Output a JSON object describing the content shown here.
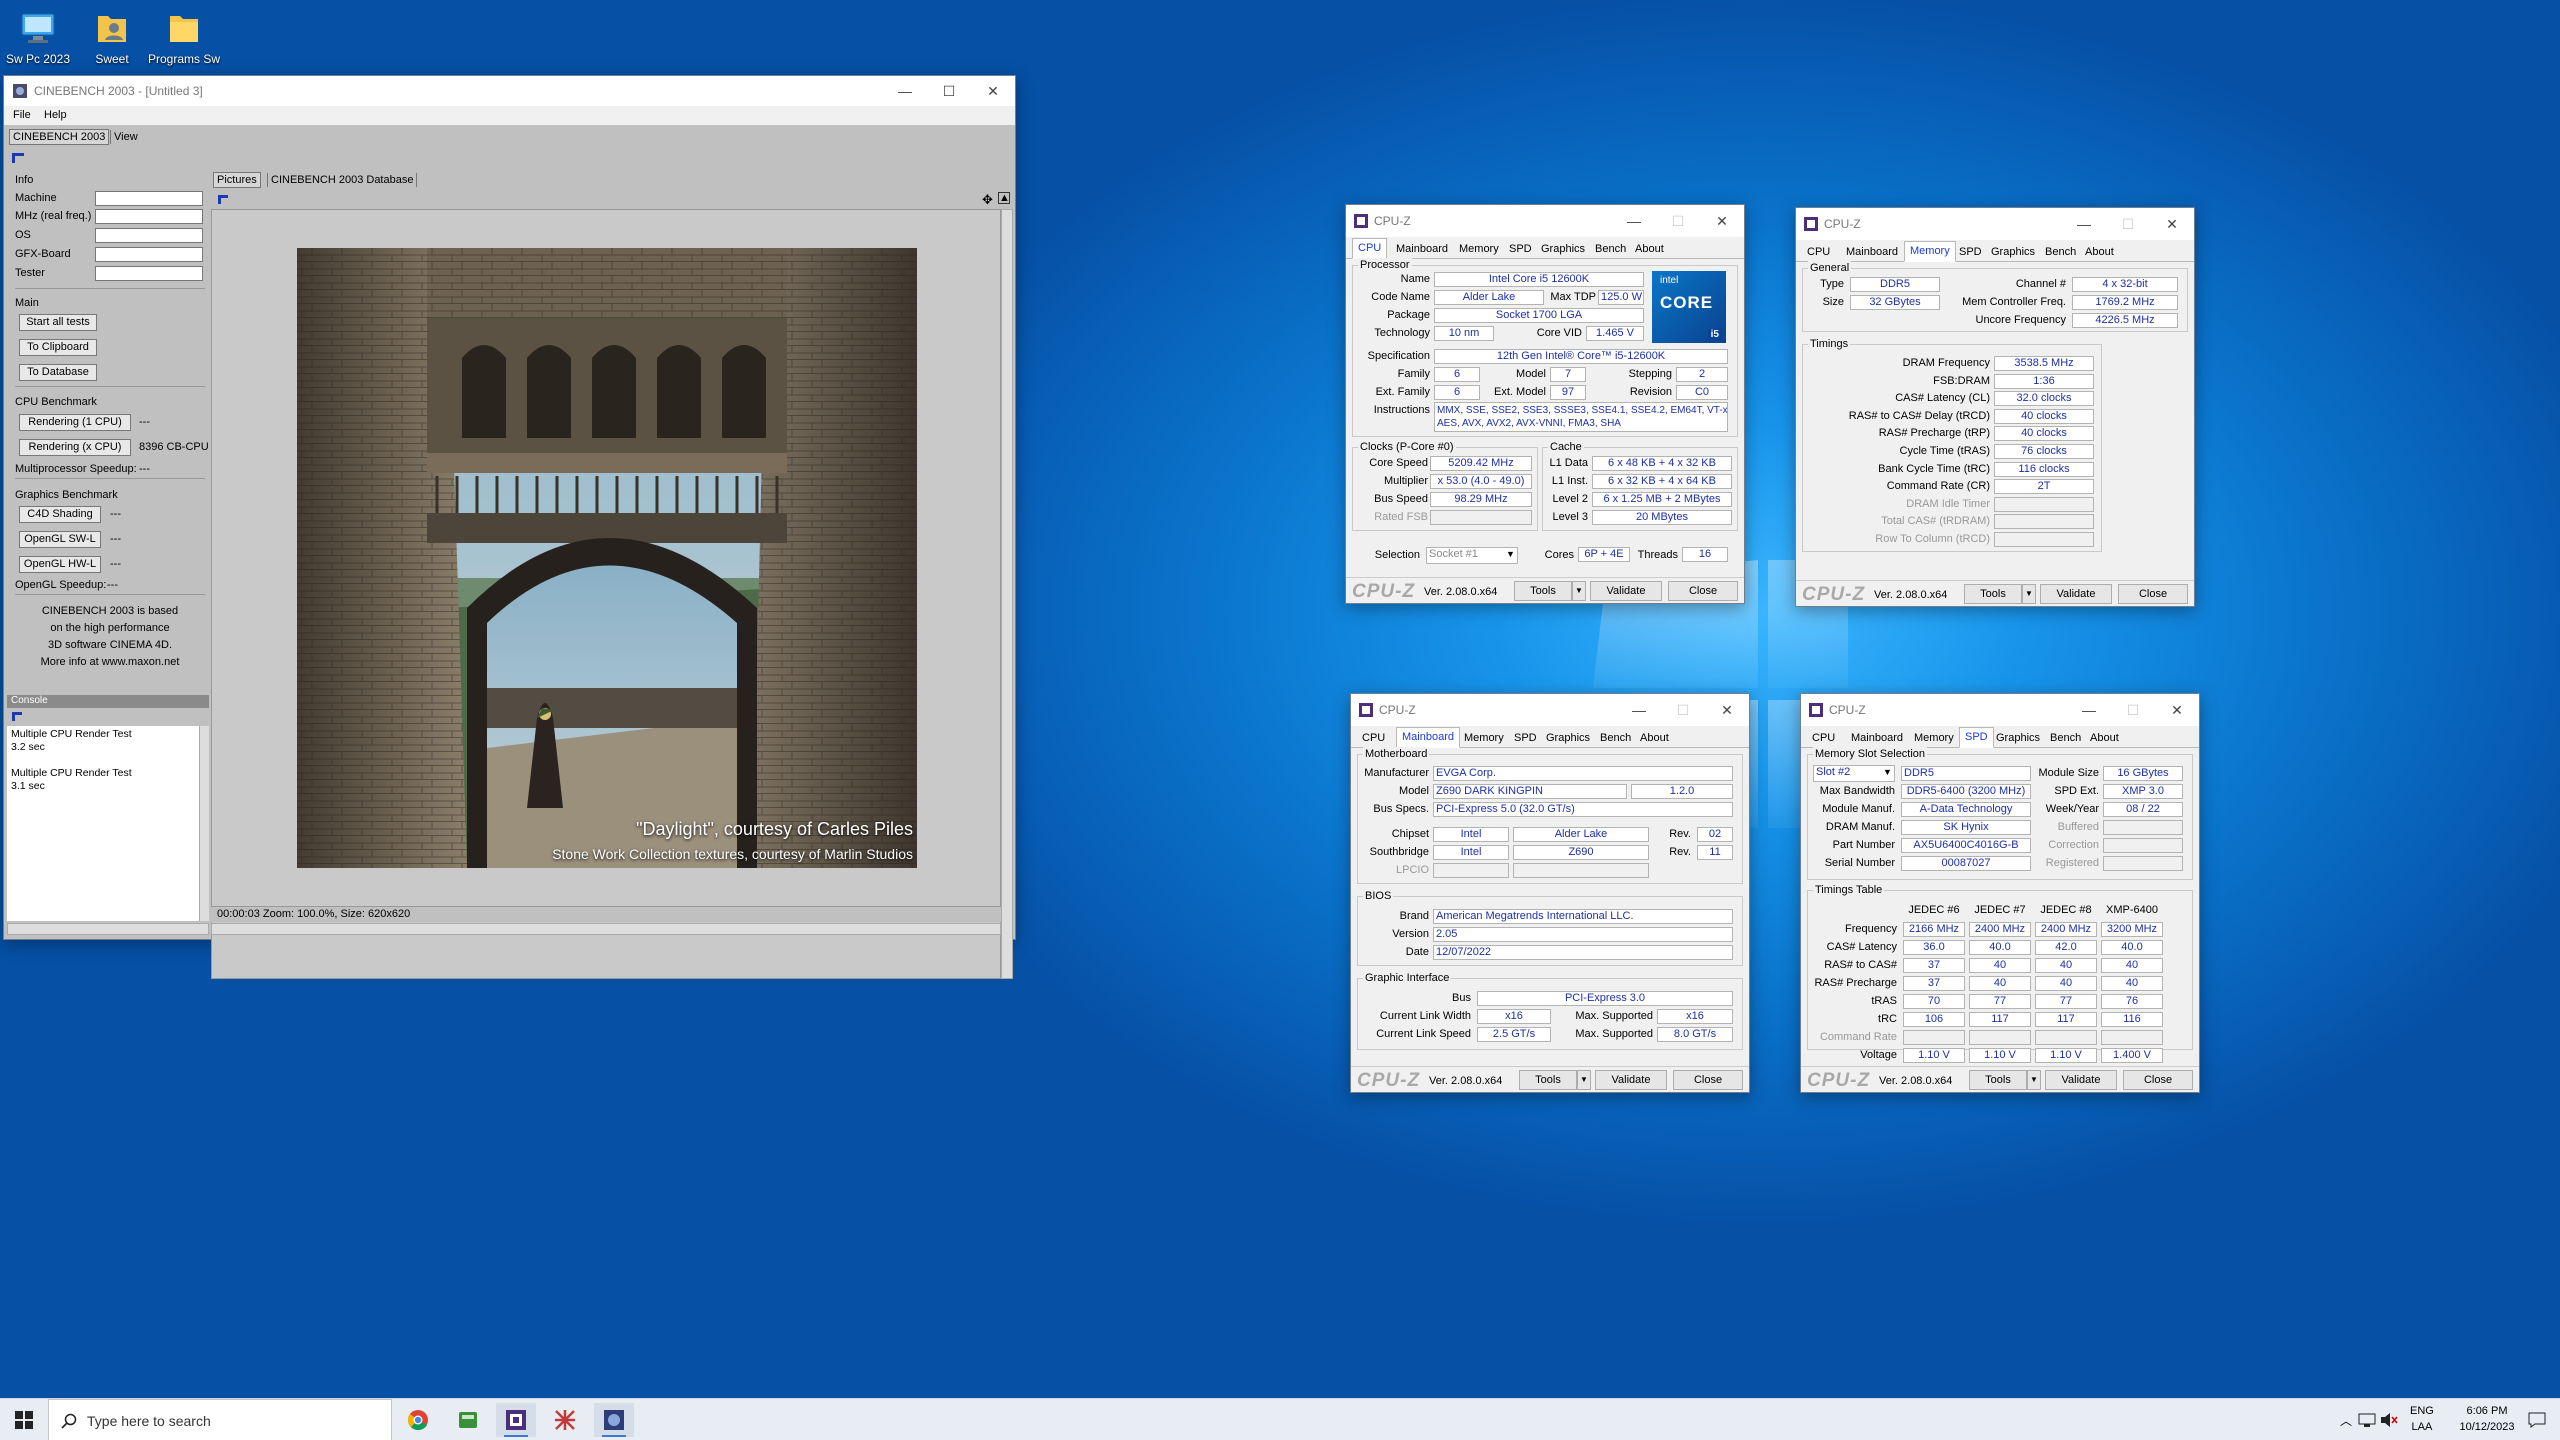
{
  "desktop_icons": [
    {
      "label": "Sw Pc 2023",
      "icon": "computer-icon"
    },
    {
      "label": "Sweet",
      "icon": "user-folder-icon"
    },
    {
      "label": "Programs Sw",
      "icon": "folder-icon"
    }
  ],
  "cinebench": {
    "title": "CINEBENCH 2003 - [Untitled 3]",
    "menu": [
      "File",
      "Help"
    ],
    "tabs": [
      "CINEBENCH 2003",
      "View"
    ],
    "info_title": "Info",
    "info_labels": [
      "Machine",
      "MHz (real freq.)",
      "OS",
      "GFX-Board",
      "Tester"
    ],
    "main_title": "Main",
    "main_buttons": [
      "Start all tests",
      "To Clipboard",
      "To Database"
    ],
    "cpu_title": "CPU Benchmark",
    "render1": "Rendering (1 CPU)",
    "render1_val": "---",
    "renderx": "Rendering (x CPU)",
    "renderx_val": "8396 CB-CPU",
    "mp_speedup": "Multiprocessor Speedup:",
    "mp_val": "---",
    "gfx_title": "Graphics Benchmark",
    "gfx_buttons": [
      "C4D Shading",
      "OpenGL SW-L",
      "OpenGL HW-L"
    ],
    "gfx_vals": [
      "---",
      "---",
      "---"
    ],
    "ogl_speedup": "OpenGL Speedup:",
    "ogl_val": "---",
    "about": [
      "CINEBENCH 2003 is based",
      "on the high performance",
      "3D software CINEMA 4D.",
      "More info at www.maxon.net"
    ],
    "console_title": "Console",
    "console_lines": [
      "Multiple CPU Render Test",
      "3.2 sec",
      "",
      "Multiple CPU Render Test",
      "3.1 sec"
    ],
    "pic_tabs": [
      "Pictures",
      "CINEBENCH 2003 Database"
    ],
    "caption1": "\"Daylight\", courtesy of Carles Piles",
    "caption2": "Stone Work Collection textures, courtesy of Marlin Studios",
    "status": "00:00:03   Zoom: 100.0%, Size: 620x620"
  },
  "cpuz_common": {
    "title": "CPU-Z",
    "tabs": [
      "CPU",
      "Mainboard",
      "Memory",
      "SPD",
      "Graphics",
      "Bench",
      "About"
    ],
    "logo": "CPU-Z",
    "version": "Ver. 2.08.0.x64",
    "tools": "Tools",
    "validate": "Validate",
    "close": "Close"
  },
  "cpuz_cpu": {
    "processor": "Processor",
    "name_l": "Name",
    "name": "Intel Core i5 12600K",
    "code_l": "Code Name",
    "code": "Alder Lake",
    "tdp_l": "Max TDP",
    "tdp": "125.0 W",
    "pkg_l": "Package",
    "pkg": "Socket 1700 LGA",
    "tech_l": "Technology",
    "tech": "10 nm",
    "vid_l": "Core VID",
    "vid": "1.465 V",
    "spec_l": "Specification",
    "spec": "12th Gen Intel® Core™ i5-12600K",
    "fam_l": "Family",
    "fam": "6",
    "model_l": "Model",
    "model": "7",
    "step_l": "Stepping",
    "step": "2",
    "efam_l": "Ext. Family",
    "efam": "6",
    "emodel_l": "Ext. Model",
    "emodel": "97",
    "rev_l": "Revision",
    "rev": "C0",
    "instr_l": "Instructions",
    "instr1": "MMX, SSE, SSE2, SSE3, SSSE3, SSE4.1, SSE4.2, EM64T, VT-x,",
    "instr2": "AES, AVX, AVX2, AVX-VNNI, FMA3, SHA",
    "clocks": "Clocks (P-Core #0)",
    "cs_l": "Core Speed",
    "cs": "5209.42 MHz",
    "mul_l": "Multiplier",
    "mul": "x 53.0 (4.0 - 49.0)",
    "bus_l": "Bus Speed",
    "bus": "98.29 MHz",
    "fsb_l": "Rated FSB",
    "cache": "Cache",
    "l1d_l": "L1 Data",
    "l1d": "6 x 48 KB + 4 x 32 KB",
    "l1i_l": "L1 Inst.",
    "l1i": "6 x 32 KB + 4 x 64 KB",
    "l2_l": "Level 2",
    "l2": "6 x 1.25 MB + 2 MBytes",
    "l3_l": "Level 3",
    "l3": "20 MBytes",
    "sel_l": "Selection",
    "sel": "Socket #1",
    "cores_l": "Cores",
    "cores": "6P + 4E",
    "thr_l": "Threads",
    "thr": "16",
    "badge_brand": "intel",
    "badge_core": "CORE",
    "badge_tier": "i5"
  },
  "cpuz_mem": {
    "general": "General",
    "type_l": "Type",
    "type": "DDR5",
    "size_l": "Size",
    "size": "32 GBytes",
    "chan_l": "Channel #",
    "chan": "4 x 32-bit",
    "mcf_l": "Mem Controller Freq.",
    "mcf": "1769.2 MHz",
    "unc_l": "Uncore Frequency",
    "unc": "4226.5 MHz",
    "timings": "Timings",
    "rows": [
      {
        "label": "DRAM Frequency",
        "value": "3538.5 MHz",
        "dim": false
      },
      {
        "label": "FSB:DRAM",
        "value": "1:36",
        "dim": false
      },
      {
        "label": "CAS# Latency (CL)",
        "value": "32.0 clocks",
        "dim": false
      },
      {
        "label": "RAS# to CAS# Delay (tRCD)",
        "value": "40 clocks",
        "dim": false
      },
      {
        "label": "RAS# Precharge (tRP)",
        "value": "40 clocks",
        "dim": false
      },
      {
        "label": "Cycle Time (tRAS)",
        "value": "76 clocks",
        "dim": false
      },
      {
        "label": "Bank Cycle Time (tRC)",
        "value": "116 clocks",
        "dim": false
      },
      {
        "label": "Command Rate (CR)",
        "value": "2T",
        "dim": false
      },
      {
        "label": "DRAM Idle Timer",
        "value": "",
        "dim": true
      },
      {
        "label": "Total CAS# (tRDRAM)",
        "value": "",
        "dim": true
      },
      {
        "label": "Row To Column (tRCD)",
        "value": "",
        "dim": true
      }
    ]
  },
  "cpuz_mb": {
    "motherboard": "Motherboard",
    "man_l": "Manufacturer",
    "man": "EVGA Corp.",
    "mod_l": "Model",
    "mod": "Z690 DARK KINGPIN",
    "mod_rev": "1.2.0",
    "bus_l": "Bus Specs.",
    "bus": "PCI-Express 5.0 (32.0 GT/s)",
    "chip_l": "Chipset",
    "chip1": "Intel",
    "chip2": "Alder Lake",
    "chip_rev_l": "Rev.",
    "chip_rev": "02",
    "sb_l": "Southbridge",
    "sb1": "Intel",
    "sb2": "Z690",
    "sb_rev_l": "Rev.",
    "sb_rev": "11",
    "lpcio_l": "LPCIO",
    "bios": "BIOS",
    "brand_l": "Brand",
    "brand": "American Megatrends International LLC.",
    "ver_l": "Version",
    "ver": "2.05",
    "date_l": "Date",
    "date": "12/07/2022",
    "gi": "Graphic Interface",
    "gbus_l": "Bus",
    "gbus": "PCI-Express 3.0",
    "clw_l": "Current Link Width",
    "clw": "x16",
    "mlw_l": "Max. Supported",
    "mlw": "x16",
    "cls_l": "Current Link Speed",
    "cls": "2.5 GT/s",
    "mls_l": "Max. Supported",
    "mls": "8.0 GT/s"
  },
  "cpuz_spd": {
    "slot_sel": "Memory Slot Selection",
    "slot": "Slot #2",
    "ddr": "DDR5",
    "msize_l": "Module Size",
    "msize": "16 GBytes",
    "bw_l": "Max Bandwidth",
    "bw": "DDR5-6400 (3200 MHz)",
    "ext_l": "SPD Ext.",
    "ext": "XMP 3.0",
    "mman_l": "Module Manuf.",
    "mman": "A-Data Technology",
    "wk_l": "Week/Year",
    "wk": "08 / 22",
    "dman_l": "DRAM Manuf.",
    "dman": "SK Hynix",
    "buf_l": "Buffered",
    "pn_l": "Part Number",
    "pn": "AX5U6400C4016G-B",
    "corr_l": "Correction",
    "sn_l": "Serial Number",
    "sn": "00087027",
    "reg_l": "Registered",
    "tt": "Timings Table",
    "cols": [
      "JEDEC #6",
      "JEDEC #7",
      "JEDEC #8",
      "XMP-6400"
    ],
    "rows": [
      {
        "label": "Frequency",
        "vals": [
          "2166 MHz",
          "2400 MHz",
          "2400 MHz",
          "3200 MHz"
        ],
        "dim": false
      },
      {
        "label": "CAS# Latency",
        "vals": [
          "36.0",
          "40.0",
          "42.0",
          "40.0"
        ],
        "dim": false
      },
      {
        "label": "RAS# to CAS#",
        "vals": [
          "37",
          "40",
          "40",
          "40"
        ],
        "dim": false
      },
      {
        "label": "RAS# Precharge",
        "vals": [
          "37",
          "40",
          "40",
          "40"
        ],
        "dim": false
      },
      {
        "label": "tRAS",
        "vals": [
          "70",
          "77",
          "77",
          "76"
        ],
        "dim": false
      },
      {
        "label": "tRC",
        "vals": [
          "106",
          "117",
          "117",
          "116"
        ],
        "dim": false
      },
      {
        "label": "Command Rate",
        "vals": [
          "",
          "",
          "",
          ""
        ],
        "dim": true
      },
      {
        "label": "Voltage",
        "vals": [
          "1.10 V",
          "1.10 V",
          "1.10 V",
          "1.400 V"
        ],
        "dim": false
      }
    ]
  },
  "taskbar": {
    "search_placeholder": "Type here to search",
    "lang1": "ENG",
    "lang2": "LAA",
    "time": "6:06 PM",
    "date": "10/12/2023"
  }
}
